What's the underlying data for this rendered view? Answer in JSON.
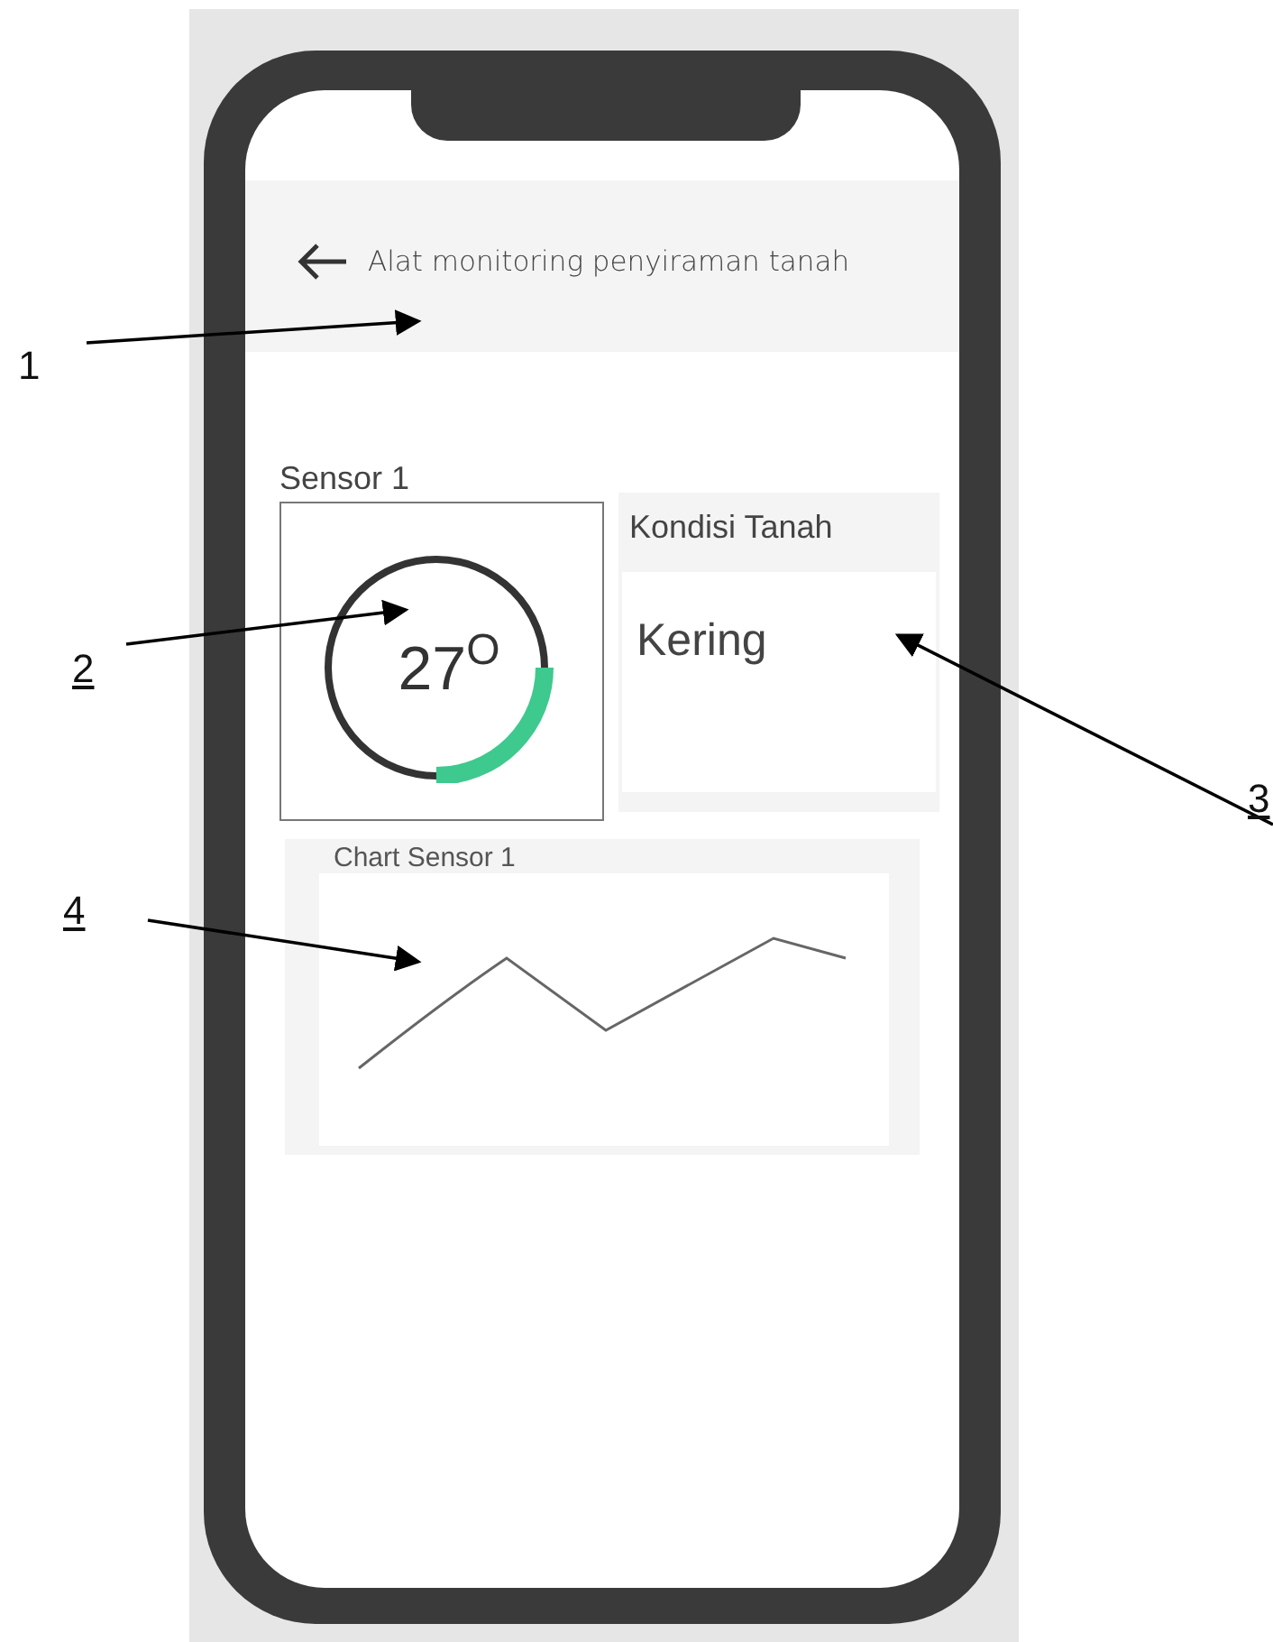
{
  "header": {
    "title": "Alat monitoring penyiraman tanah"
  },
  "sensor": {
    "label": "Sensor 1",
    "value": "27$^{O}$",
    "level": 0.25
  },
  "soil": {
    "title": "Kondisi Tanah",
    "status": "Kering"
  },
  "chart": {
    "title": "Chart Sensor 1"
  },
  "annotations": [
    {
      "label": "1",
      "underlined": false
    },
    {
      "label": "2",
      "underlined": true
    },
    {
      "label": "3",
      "underlined": true
    },
    {
      "label": "4",
      "underlined": true
    }
  ]
}
